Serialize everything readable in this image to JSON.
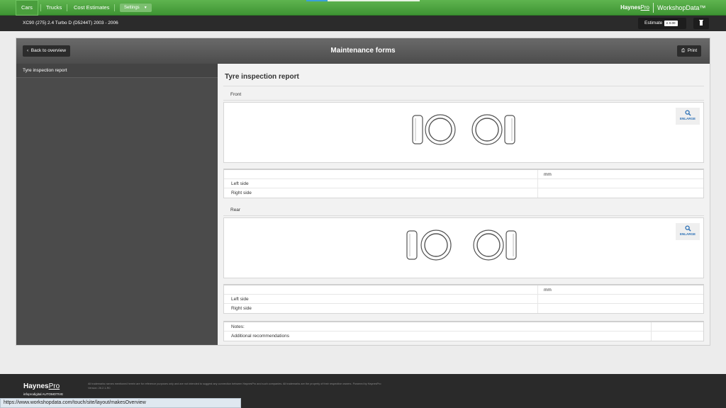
{
  "nav": {
    "tabs": [
      {
        "label": "Cars",
        "active": true
      },
      {
        "label": "Trucks",
        "active": false
      },
      {
        "label": "Cost Estimates",
        "active": false
      }
    ],
    "settings_label": "Settings",
    "brand_main": "Haynes",
    "brand_pro": "Pro",
    "product": "WorkshopData™"
  },
  "vehicle": {
    "title": "XC90 (275) 2.4 Turbo D (D5244T) 2003 - 2006",
    "estimate_label": "Estimate",
    "estimate_value": "£ 0.00"
  },
  "panel": {
    "title": "Maintenance forms",
    "back_label": "Back to overview",
    "print_label": "Print"
  },
  "sidebar": {
    "items": [
      {
        "label": "Tyre inspection report"
      }
    ]
  },
  "content": {
    "title": "Tyre inspection report",
    "front": {
      "label": "Front",
      "enlarge": "ENLARGE",
      "unit": "mm",
      "rows": [
        {
          "label": "Left side",
          "value": ""
        },
        {
          "label": "Right side",
          "value": ""
        }
      ]
    },
    "rear": {
      "label": "Rear",
      "enlarge": "ENLARGE",
      "unit": "mm",
      "rows": [
        {
          "label": "Left side",
          "value": ""
        },
        {
          "label": "Right side",
          "value": ""
        }
      ]
    },
    "notes": {
      "rows": [
        {
          "label": "Notes:"
        },
        {
          "label": "Additional recommendations"
        }
      ]
    }
  },
  "footer": {
    "logo_main": "Haynes",
    "logo_pro": "Pro",
    "sub": "infoprodigital AUTOMOTIVE",
    "legal": "All trademarks names mentioned herein are for reference purposes only and are not intended to suggest any connection between HaynesPro and such companies. All trademarks are the property of their respective owners. Powered by HaynesPro",
    "version": "Version: 26.2.1-R0"
  },
  "status_url": "https://www.workshopdata.com/touch/site/layout/makesOverview",
  "colors": {
    "nav_green": "#4ca23f",
    "link_blue": "#2a6fb5",
    "dark": "#2b2b2b"
  }
}
